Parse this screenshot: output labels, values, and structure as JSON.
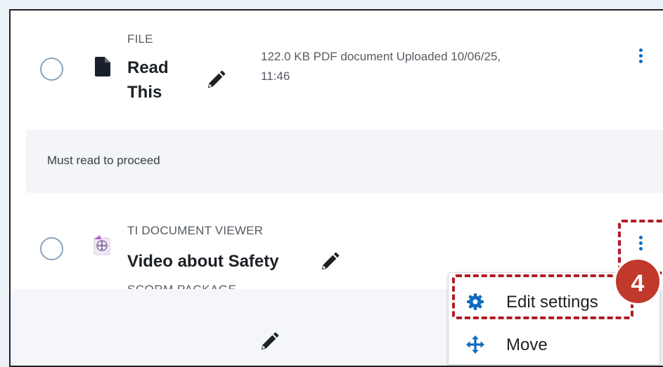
{
  "items": [
    {
      "type": "FILE",
      "title_line1": "Read",
      "title_line2": "This",
      "meta_line1": "122.0 KB PDF document Uploaded 10/06/25,",
      "meta_line2": "11:46"
    },
    {
      "type": "TI DOCUMENT VIEWER",
      "title": "Video about Safety"
    }
  ],
  "notice": "Must read to proceed",
  "peek_label": "SCORM PACKAGE",
  "menu": {
    "edit_settings": "Edit settings",
    "move": "Move"
  },
  "step_badge": "4",
  "colors": {
    "accent": "#0f6cbf",
    "highlight": "#b11c24",
    "badge": "#c0392b"
  }
}
